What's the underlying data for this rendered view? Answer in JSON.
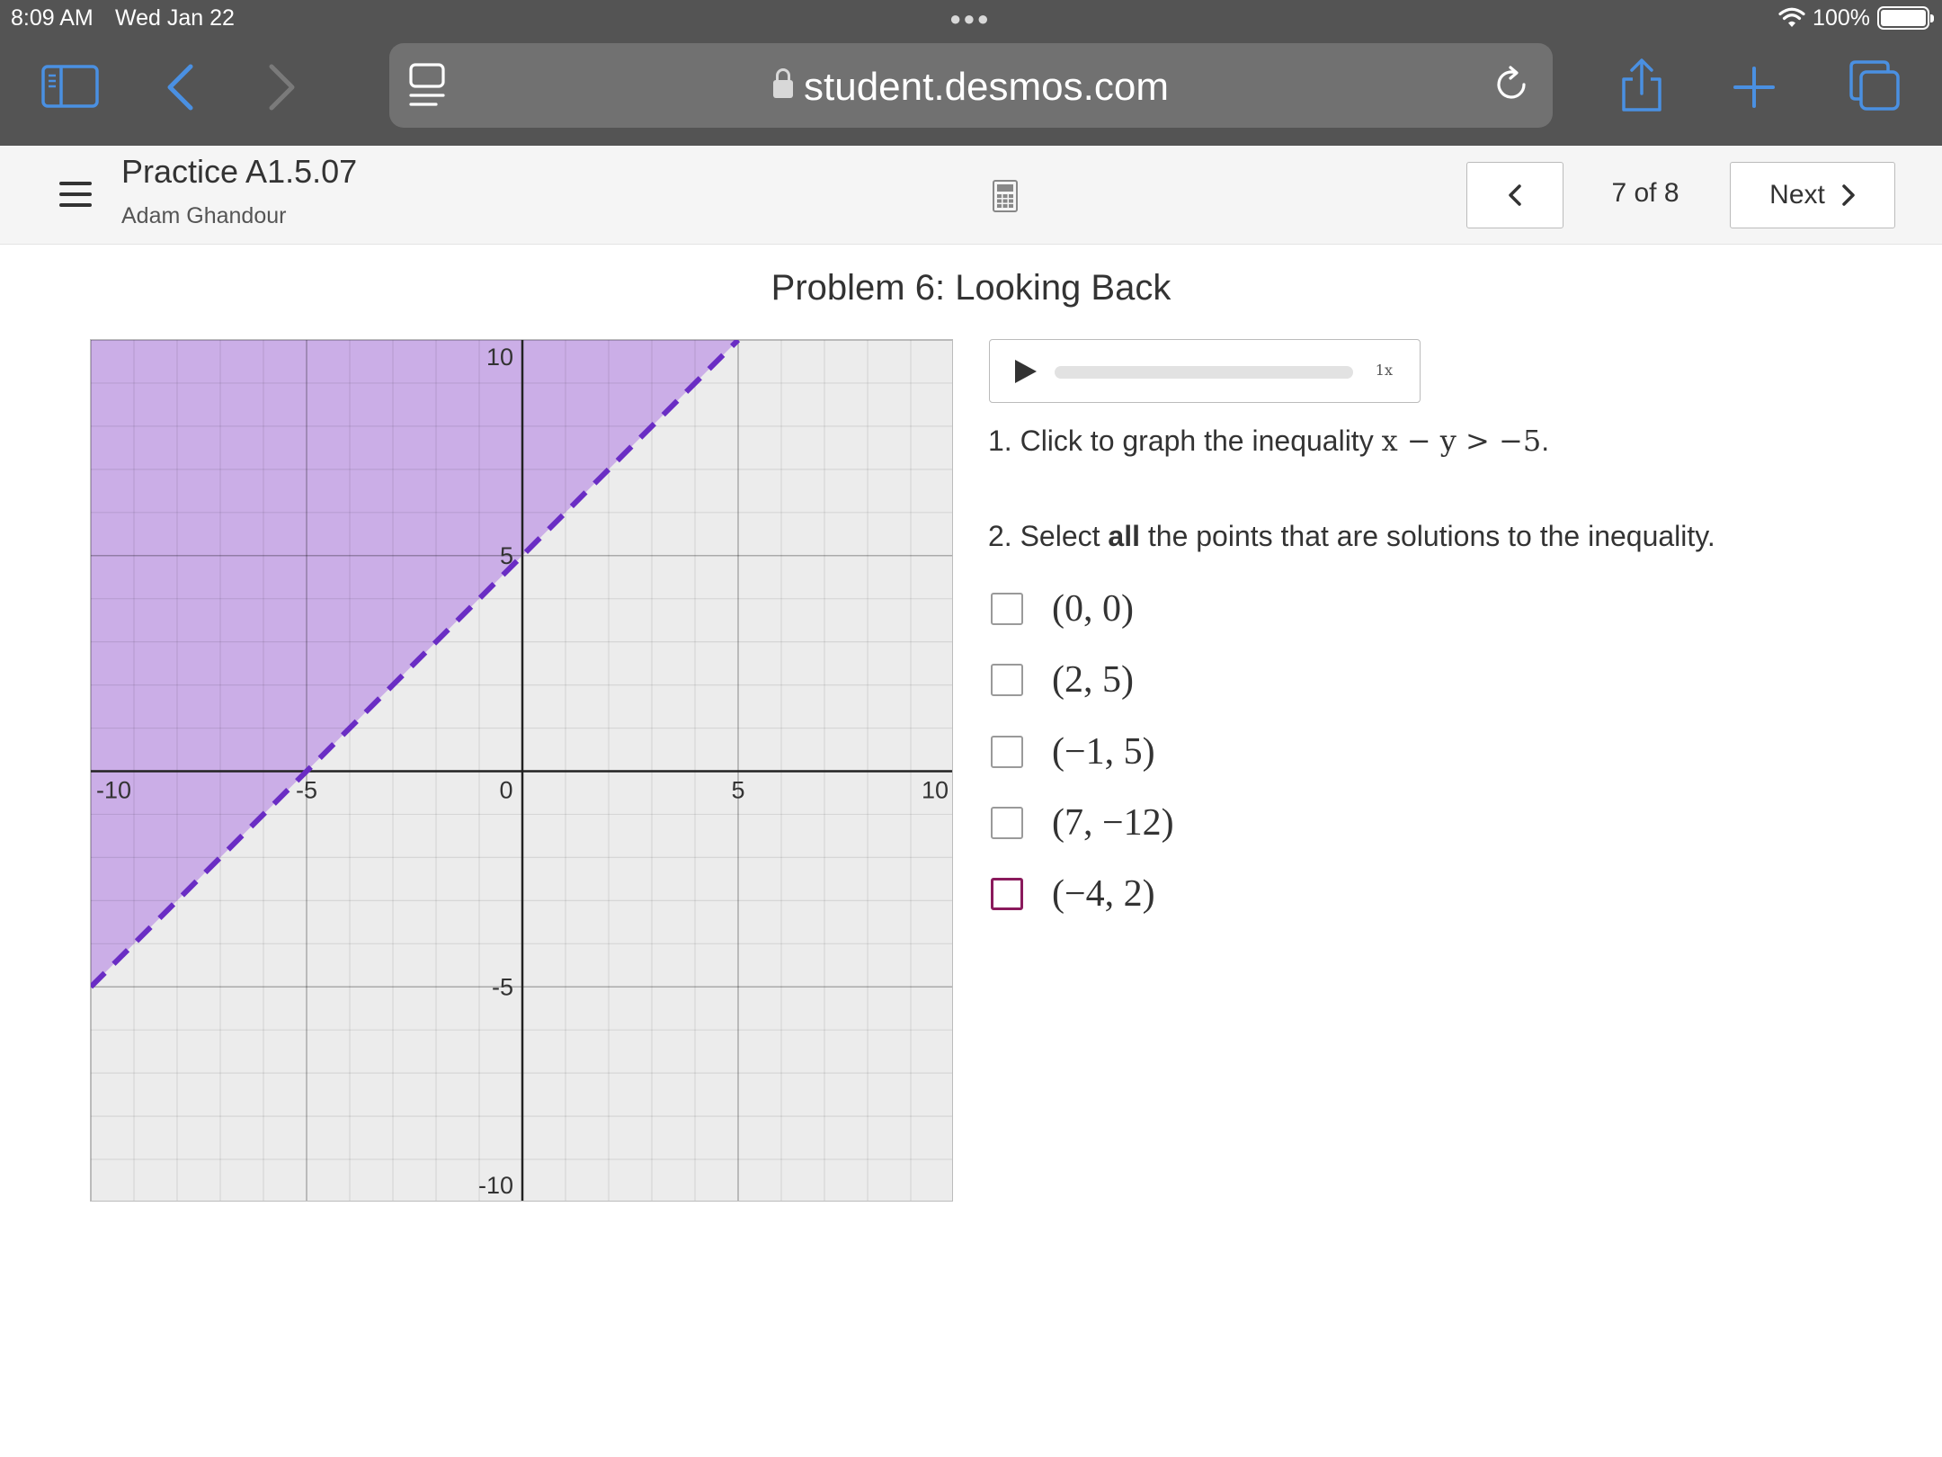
{
  "status": {
    "time": "8:09 AM",
    "date": "Wed Jan 22",
    "battery": "100%"
  },
  "browser": {
    "url": "student.desmos.com"
  },
  "header": {
    "activity_title": "Practice A1.5.07",
    "student_name": "Adam Ghandour",
    "page_indicator": "7 of 8",
    "next_label": "Next"
  },
  "problem": {
    "title": "Problem 6: Looking Back",
    "audio_speed": "1x",
    "q1_prefix": "1. Click to graph the inequality",
    "q1_math": "x − y > −5",
    "q1_suffix": ".",
    "q2_prefix": "2. Select",
    "q2_bold": "all",
    "q2_suffix": "the points that are solutions to the inequality."
  },
  "choices": [
    {
      "label": "(0, 0)",
      "checked": false
    },
    {
      "label": "(2, 5)",
      "checked": false
    },
    {
      "label": "(−1, 5)",
      "checked": false
    },
    {
      "label": "(7, −12)",
      "checked": false
    },
    {
      "label": "(−4, 2)",
      "checked": false,
      "focused": true
    }
  ],
  "chart_data": {
    "type": "line",
    "xlim": [
      -10,
      10
    ],
    "ylim": [
      -10,
      10
    ],
    "grid": true,
    "x_tick_labels": [
      "-10",
      "-5",
      "0",
      "5",
      "10"
    ],
    "y_tick_labels": [
      "10",
      "5",
      "-5",
      "-10"
    ],
    "boundary": {
      "equation": "y = x + 5",
      "style": "dashed",
      "color": "#6a2dc4"
    },
    "shaded_region": {
      "side": "above boundary",
      "color": "#c8a8e6"
    }
  }
}
